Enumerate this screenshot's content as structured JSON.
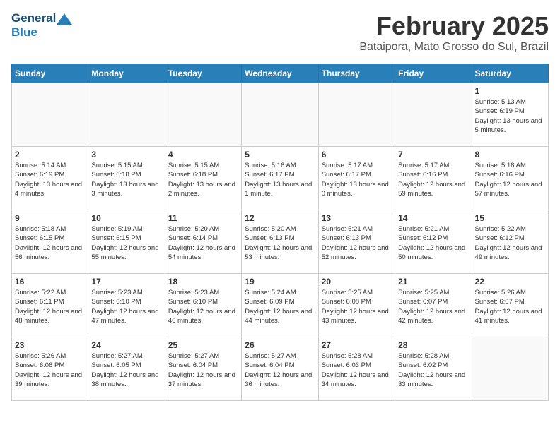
{
  "header": {
    "logo_line1": "General",
    "logo_line2": "Blue",
    "month_title": "February 2025",
    "location": "Bataipora, Mato Grosso do Sul, Brazil"
  },
  "weekdays": [
    "Sunday",
    "Monday",
    "Tuesday",
    "Wednesday",
    "Thursday",
    "Friday",
    "Saturday"
  ],
  "weeks": [
    [
      {
        "day": null
      },
      {
        "day": null
      },
      {
        "day": null
      },
      {
        "day": null
      },
      {
        "day": null
      },
      {
        "day": null
      },
      {
        "day": 1,
        "sunrise": "5:13 AM",
        "sunset": "6:19 PM",
        "daylight": "13 hours and 5 minutes."
      }
    ],
    [
      {
        "day": 2,
        "sunrise": "5:14 AM",
        "sunset": "6:19 PM",
        "daylight": "13 hours and 4 minutes."
      },
      {
        "day": 3,
        "sunrise": "5:15 AM",
        "sunset": "6:18 PM",
        "daylight": "13 hours and 3 minutes."
      },
      {
        "day": 4,
        "sunrise": "5:15 AM",
        "sunset": "6:18 PM",
        "daylight": "13 hours and 2 minutes."
      },
      {
        "day": 5,
        "sunrise": "5:16 AM",
        "sunset": "6:17 PM",
        "daylight": "13 hours and 1 minute."
      },
      {
        "day": 6,
        "sunrise": "5:17 AM",
        "sunset": "6:17 PM",
        "daylight": "13 hours and 0 minutes."
      },
      {
        "day": 7,
        "sunrise": "5:17 AM",
        "sunset": "6:16 PM",
        "daylight": "12 hours and 59 minutes."
      },
      {
        "day": 8,
        "sunrise": "5:18 AM",
        "sunset": "6:16 PM",
        "daylight": "12 hours and 57 minutes."
      }
    ],
    [
      {
        "day": 9,
        "sunrise": "5:18 AM",
        "sunset": "6:15 PM",
        "daylight": "12 hours and 56 minutes."
      },
      {
        "day": 10,
        "sunrise": "5:19 AM",
        "sunset": "6:15 PM",
        "daylight": "12 hours and 55 minutes."
      },
      {
        "day": 11,
        "sunrise": "5:20 AM",
        "sunset": "6:14 PM",
        "daylight": "12 hours and 54 minutes."
      },
      {
        "day": 12,
        "sunrise": "5:20 AM",
        "sunset": "6:13 PM",
        "daylight": "12 hours and 53 minutes."
      },
      {
        "day": 13,
        "sunrise": "5:21 AM",
        "sunset": "6:13 PM",
        "daylight": "12 hours and 52 minutes."
      },
      {
        "day": 14,
        "sunrise": "5:21 AM",
        "sunset": "6:12 PM",
        "daylight": "12 hours and 50 minutes."
      },
      {
        "day": 15,
        "sunrise": "5:22 AM",
        "sunset": "6:12 PM",
        "daylight": "12 hours and 49 minutes."
      }
    ],
    [
      {
        "day": 16,
        "sunrise": "5:22 AM",
        "sunset": "6:11 PM",
        "daylight": "12 hours and 48 minutes."
      },
      {
        "day": 17,
        "sunrise": "5:23 AM",
        "sunset": "6:10 PM",
        "daylight": "12 hours and 47 minutes."
      },
      {
        "day": 18,
        "sunrise": "5:23 AM",
        "sunset": "6:10 PM",
        "daylight": "12 hours and 46 minutes."
      },
      {
        "day": 19,
        "sunrise": "5:24 AM",
        "sunset": "6:09 PM",
        "daylight": "12 hours and 44 minutes."
      },
      {
        "day": 20,
        "sunrise": "5:25 AM",
        "sunset": "6:08 PM",
        "daylight": "12 hours and 43 minutes."
      },
      {
        "day": 21,
        "sunrise": "5:25 AM",
        "sunset": "6:07 PM",
        "daylight": "12 hours and 42 minutes."
      },
      {
        "day": 22,
        "sunrise": "5:26 AM",
        "sunset": "6:07 PM",
        "daylight": "12 hours and 41 minutes."
      }
    ],
    [
      {
        "day": 23,
        "sunrise": "5:26 AM",
        "sunset": "6:06 PM",
        "daylight": "12 hours and 39 minutes."
      },
      {
        "day": 24,
        "sunrise": "5:27 AM",
        "sunset": "6:05 PM",
        "daylight": "12 hours and 38 minutes."
      },
      {
        "day": 25,
        "sunrise": "5:27 AM",
        "sunset": "6:04 PM",
        "daylight": "12 hours and 37 minutes."
      },
      {
        "day": 26,
        "sunrise": "5:27 AM",
        "sunset": "6:04 PM",
        "daylight": "12 hours and 36 minutes."
      },
      {
        "day": 27,
        "sunrise": "5:28 AM",
        "sunset": "6:03 PM",
        "daylight": "12 hours and 34 minutes."
      },
      {
        "day": 28,
        "sunrise": "5:28 AM",
        "sunset": "6:02 PM",
        "daylight": "12 hours and 33 minutes."
      },
      {
        "day": null
      }
    ]
  ],
  "labels": {
    "sunrise": "Sunrise:",
    "sunset": "Sunset:",
    "daylight": "Daylight:"
  }
}
